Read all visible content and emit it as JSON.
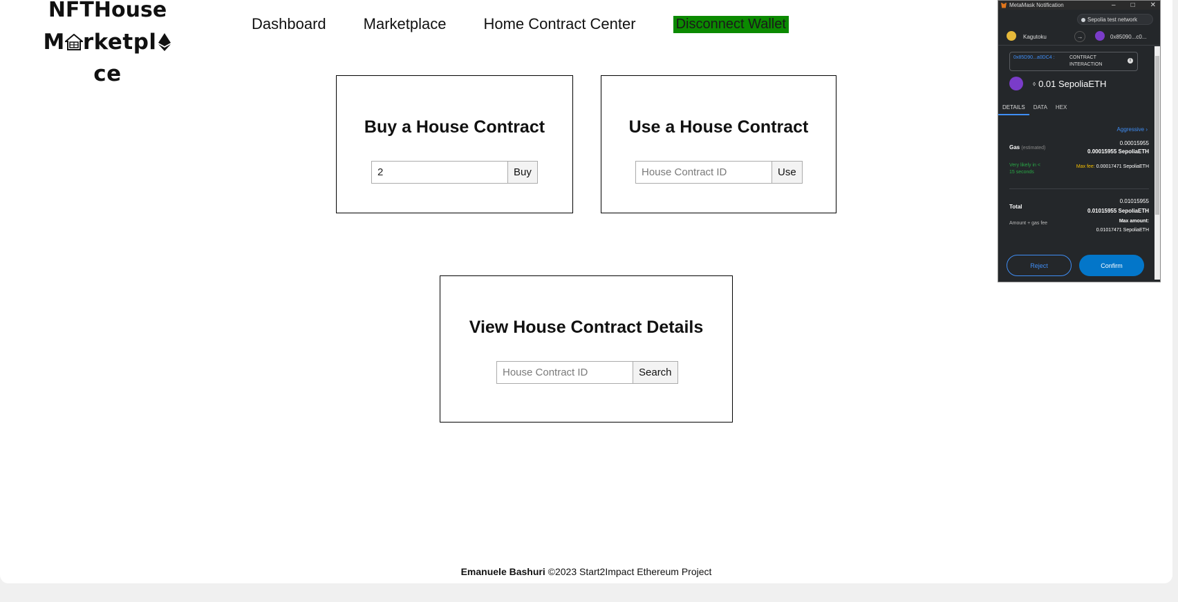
{
  "logo": {
    "line1": "NFTHouse",
    "line2_start": "M",
    "line2_mid": "rketpl",
    "line2_end": "ce"
  },
  "nav": {
    "items": [
      {
        "label": "Dashboard"
      },
      {
        "label": "Marketplace"
      },
      {
        "label": "Home Contract Center"
      }
    ],
    "disconnect_label": "Disconnect Wallet"
  },
  "cards": {
    "buy": {
      "title": "Buy a House Contract",
      "input_value": "2",
      "button_label": "Buy"
    },
    "use": {
      "title": "Use a House Contract",
      "input_placeholder": "House Contract ID",
      "button_label": "Use"
    },
    "view": {
      "title": "View House Contract Details",
      "input_placeholder": "House Contract ID",
      "button_label": "Search"
    }
  },
  "footer": {
    "author": "Emanuele Bashuri",
    "text": " ©2023 Start2Impact Ethereum Project"
  },
  "metamask": {
    "window_title": "MetaMask Notification",
    "window_buttons": [
      "–",
      "□",
      "✕"
    ],
    "network": "Sepolia test network",
    "from_account": "Kagutoku",
    "to_account": "0x85090...c0...",
    "contract_address": "0x85D90...a0DC4 :",
    "contract_type": "CONTRACT INTERACTION",
    "amount_prefix": "⬨",
    "amount": "0.01 SepoliaETH",
    "tabs": [
      "DETAILS",
      "DATA",
      "HEX"
    ],
    "active_tab": "DETAILS",
    "gas_speed": "Aggressive ›",
    "gas_label": "Gas",
    "gas_estimated": "(estimated)",
    "gas_value": "0.00015955",
    "gas_value_eth": "0.00015955 SepoliaETH",
    "likely_text": "Very likely in < 15 seconds",
    "max_fee_label": "Max fee:",
    "max_fee_value": "0.00017471 SepoliaETH",
    "total_label": "Total",
    "total_value": "0.01015955",
    "total_value_eth": "0.01015955 SepoliaETH",
    "amount_gas_label": "Amount + gas fee",
    "max_amount_label": "Max amount:",
    "max_amount_value": "0.01017471 SepoliaETH",
    "reject_label": "Reject",
    "confirm_label": "Confirm",
    "colors": {
      "background": "#24272a",
      "accent_blue": "#3f8ef6",
      "confirm_blue": "#0376c9",
      "green": "#28a745",
      "warning": "#f8c000"
    }
  },
  "colors": {
    "disconnect_bg": "#0b8a00",
    "page_bg": "#ffffff"
  }
}
